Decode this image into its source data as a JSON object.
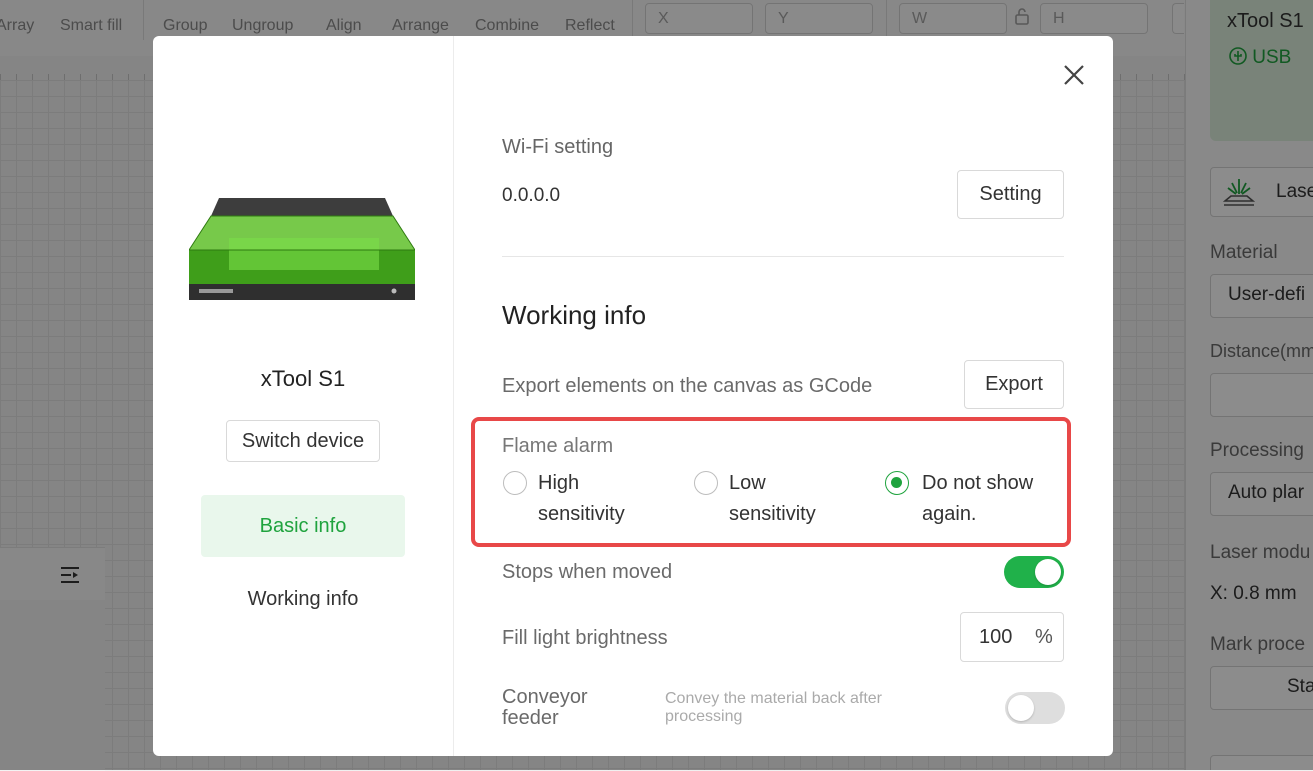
{
  "toolbar": {
    "tools": [
      "Array",
      "Smart fill",
      "Group",
      "Ungroup",
      "Align",
      "Arrange",
      "Combine",
      "Reflect"
    ],
    "fields": {
      "x": "X",
      "y": "Y",
      "w": "W",
      "h": "H"
    }
  },
  "right_panel": {
    "device_name": "xTool S1",
    "connection": "USB",
    "laser_button": "Lase",
    "material_label": "Material",
    "material_value": "User-defi",
    "distance_label": "Distance(mm",
    "processing_label": "Processing",
    "processing_value": "Auto plar",
    "laser_module_label": "Laser modu",
    "laser_module_value": "X: 0.8 mm",
    "mark_label": "Mark proce",
    "mark_button": "Sta"
  },
  "modal": {
    "device_name": "xTool S1",
    "switch_device": "Switch device",
    "nav": {
      "basic_info": "Basic info",
      "working_info": "Working info"
    },
    "wifi": {
      "label": "Wi-Fi setting",
      "value": "0.0.0.0",
      "button": "Setting"
    },
    "working_heading": "Working info",
    "export": {
      "label": "Export elements on the canvas as GCode",
      "button": "Export"
    },
    "flame_alarm": {
      "label": "Flame alarm",
      "options": [
        {
          "line1": "High",
          "line2": "sensitivity",
          "selected": false
        },
        {
          "line1": "Low",
          "line2": "sensitivity",
          "selected": false
        },
        {
          "line1": "Do not show",
          "line2": "again.",
          "selected": true
        }
      ]
    },
    "stops_when_moved": {
      "label": "Stops when moved",
      "enabled": true
    },
    "fill_light": {
      "label": "Fill light brightness",
      "value": "100",
      "unit": "%"
    },
    "conveyor": {
      "label_line1": "Conveyor",
      "label_line2": "feeder",
      "description_line1": "Convey the material back after",
      "description_line2": "processing",
      "enabled": false
    }
  },
  "colors": {
    "accent": "#1fa33e",
    "highlight_border": "#e84848",
    "toggle_on": "#20b14a"
  }
}
